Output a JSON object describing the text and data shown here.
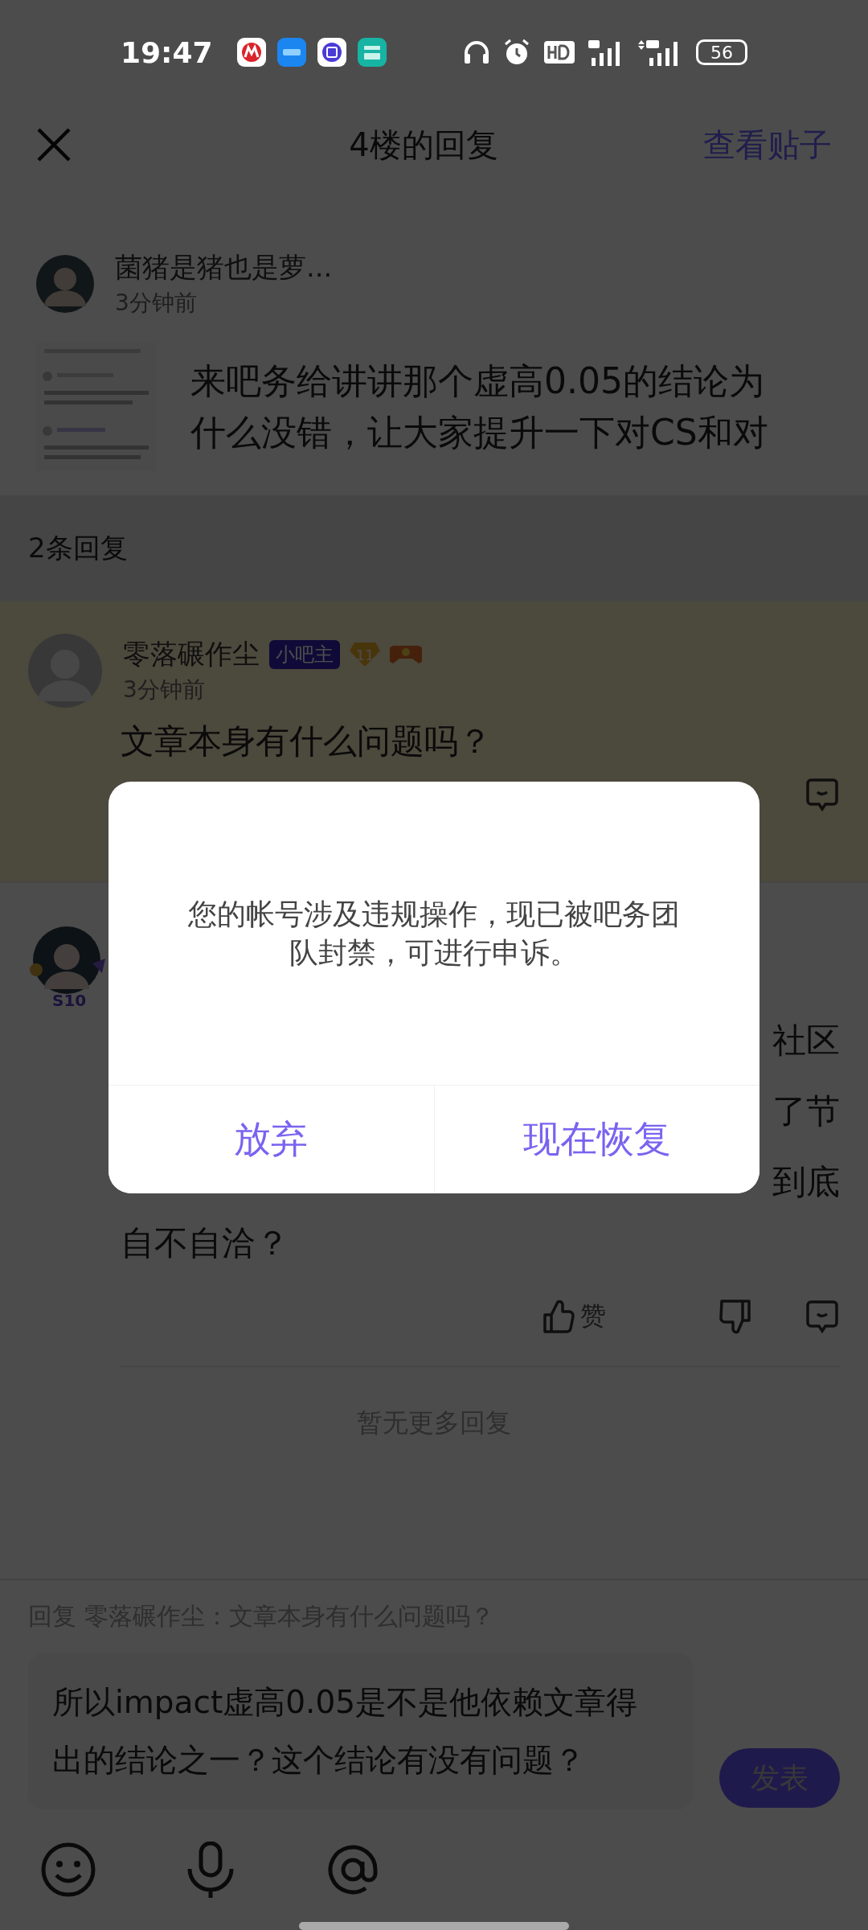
{
  "status_bar": {
    "time": "19:47",
    "battery": "56"
  },
  "header": {
    "title": "4楼的回复",
    "action": "查看贴子"
  },
  "post": {
    "author": "菌猪是猪也是萝...",
    "time": "3分钟前",
    "lines": [
      "来吧务给讲讲那个虚高0.05的结论为",
      "什么没错，让大家提升一下对CS和对"
    ]
  },
  "reply_count": "2条回复",
  "first_reply": {
    "highlighted": true,
    "author": "零落碾作尘",
    "badge": "小吧主",
    "level": "11",
    "time": "3分钟前",
    "text": "文章本身有什么问题吗？"
  },
  "second_reply": {
    "avatar_badge": "S10",
    "line_endings": [
      "社区",
      "了节",
      "到底"
    ],
    "last_line": "自不自洽？",
    "like_label": "赞"
  },
  "no_more": "暂无更多回复",
  "composer": {
    "reply_to": "回复 零落碾作尘：文章本身有什么问题吗？",
    "value_lines": [
      "所以impact虚高0.05是不是他依赖文章得",
      "出的结论之一？这个结论有没有问题？"
    ],
    "send": "发表"
  },
  "dialog": {
    "message": "您的帐号涉及违规操作，现已被吧务团队封禁，可进行申诉。",
    "buttons": [
      "放弃",
      "现在恢复"
    ]
  }
}
